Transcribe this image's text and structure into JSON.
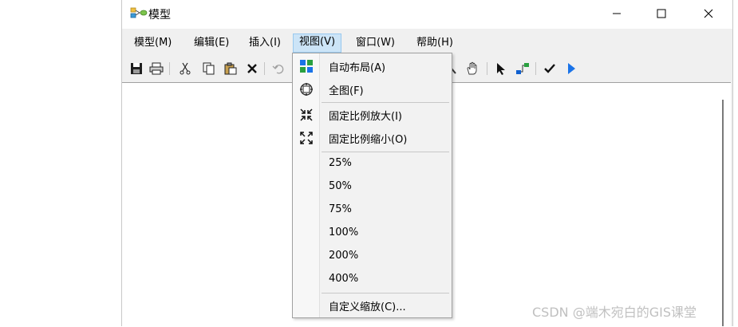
{
  "window": {
    "title": "模型"
  },
  "menubar": {
    "items": [
      "模型(M)",
      "编辑(E)",
      "插入(I)",
      "视图(V)",
      "窗口(W)",
      "帮助(H)"
    ],
    "active_index": 3
  },
  "view_menu": {
    "items": [
      {
        "label": "自动布局(A)",
        "icon": "auto-layout-icon"
      },
      {
        "label": "全图(F)",
        "icon": "full-extent-icon"
      },
      {
        "label": "固定比例放大(I)",
        "icon": "fixed-zoom-in-icon"
      },
      {
        "label": "固定比例缩小(O)",
        "icon": "fixed-zoom-out-icon"
      },
      {
        "label": "25%"
      },
      {
        "label": "50%"
      },
      {
        "label": "75%"
      },
      {
        "label": "100%"
      },
      {
        "label": "200%"
      },
      {
        "label": "400%"
      },
      {
        "label": "自定义缩放(C)..."
      }
    ]
  },
  "watermark": "CSDN @端木宛白的GIS课堂",
  "colors": {
    "accent": "#0078d7",
    "menu_highlight": "#cce4f7"
  }
}
